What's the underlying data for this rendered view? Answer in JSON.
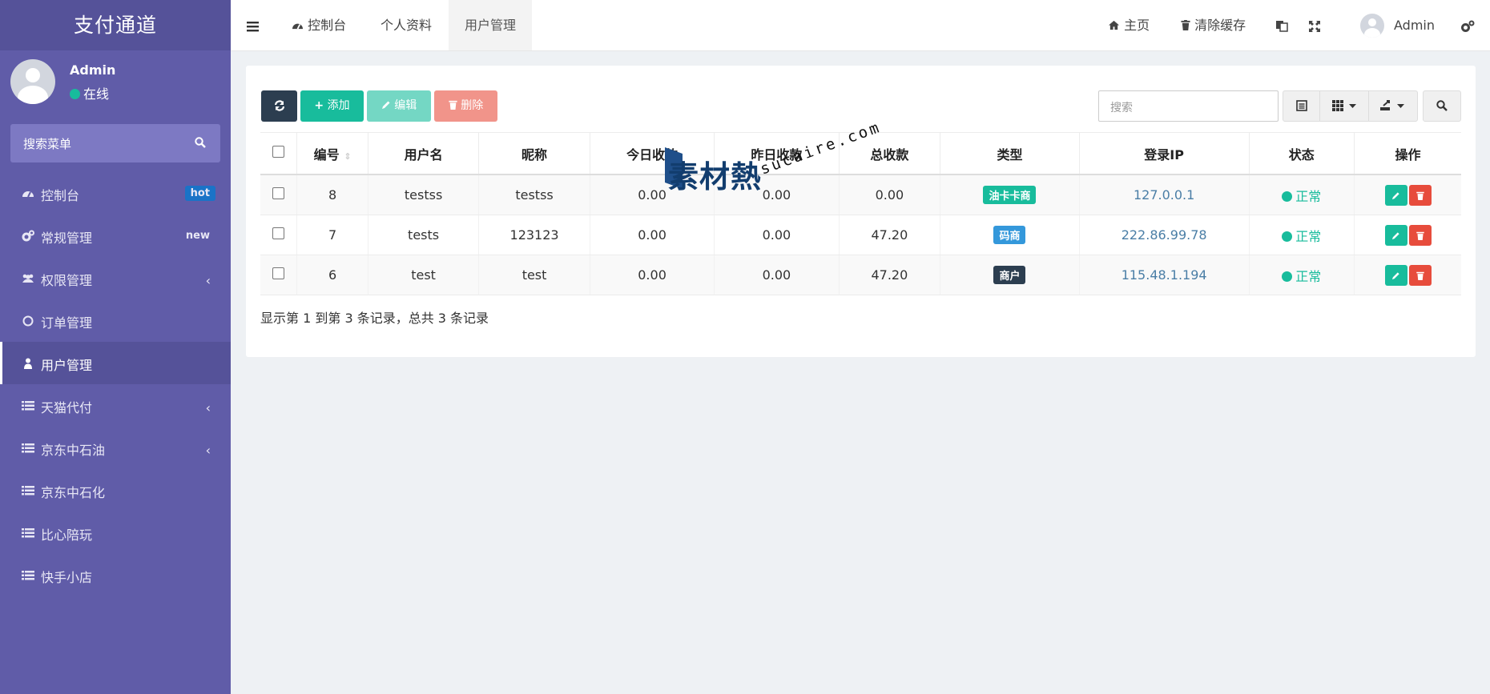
{
  "colors": {
    "sidebar_bg": "#605ca8",
    "primary_dark": "#2c3e50",
    "success": "#18bc9c",
    "danger": "#e74c3c",
    "info": "#3498db"
  },
  "sidebar": {
    "brand": "支付通道",
    "user_name": "Admin",
    "user_status": "在线",
    "search_placeholder": "搜索菜单",
    "items": [
      {
        "label": "控制台",
        "icon": "dashboard-icon",
        "badge": "hot"
      },
      {
        "label": "常规管理",
        "icon": "cogs-icon",
        "badge": "new"
      },
      {
        "label": "权限管理",
        "icon": "group-icon",
        "chevron": "‹"
      },
      {
        "label": "订单管理",
        "icon": "circle-icon"
      },
      {
        "label": "用户管理",
        "icon": "user-icon",
        "active": true
      },
      {
        "label": "天猫代付",
        "icon": "list-icon",
        "chevron": "‹"
      },
      {
        "label": "京东中石油",
        "icon": "list-icon",
        "chevron": "‹"
      },
      {
        "label": "京东中石化",
        "icon": "list-icon"
      },
      {
        "label": "比心陪玩",
        "icon": "list-icon"
      },
      {
        "label": "快手小店",
        "icon": "list-icon"
      }
    ]
  },
  "topbar": {
    "tabs": [
      "控制台",
      "个人资料",
      "用户管理"
    ],
    "home": "主页",
    "clear_cache": "清除缓存",
    "admin": "Admin"
  },
  "toolbar": {
    "add": "添加",
    "edit": "编辑",
    "delete": "删除",
    "search_placeholder": "搜索"
  },
  "table": {
    "headers": [
      "编号",
      "用户名",
      "昵称",
      "今日收款",
      "昨日收款",
      "总收款",
      "类型",
      "登录IP",
      "状态",
      "操作"
    ],
    "rows": [
      {
        "id": "8",
        "username": "testss",
        "nickname": "testss",
        "today": "0.00",
        "yesterday": "0.00",
        "total": "0.00",
        "type": "油卡卡商",
        "type_color": "#18bc9c",
        "ip": "127.0.0.1",
        "status": "正常"
      },
      {
        "id": "7",
        "username": "tests",
        "nickname": "123123",
        "today": "0.00",
        "yesterday": "0.00",
        "total": "47.20",
        "type": "码商",
        "type_color": "#3498db",
        "ip": "222.86.99.78",
        "status": "正常"
      },
      {
        "id": "6",
        "username": "test",
        "nickname": "test",
        "today": "0.00",
        "yesterday": "0.00",
        "total": "47.20",
        "type": "商户",
        "type_color": "#2c3e50",
        "ip": "115.48.1.194",
        "status": "正常"
      }
    ],
    "summary": "显示第 1 到第 3 条记录，总共 3 条记录"
  },
  "watermark": {
    "cn": "素材熱",
    "url": "sucaire.com"
  }
}
